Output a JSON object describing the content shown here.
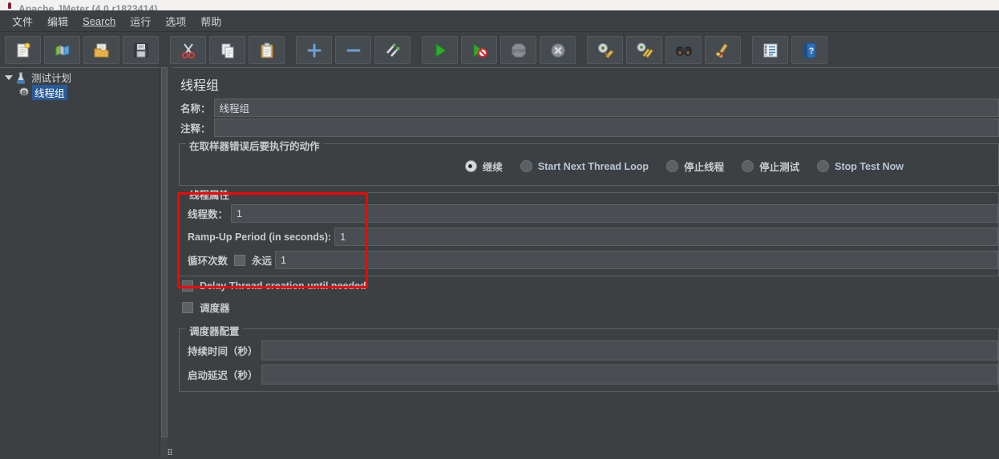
{
  "window": {
    "title": "Apache JMeter (4.0 r1823414)"
  },
  "menubar": {
    "items": [
      {
        "label": "文件",
        "name": "menu-file"
      },
      {
        "label": "编辑",
        "name": "menu-edit"
      },
      {
        "label": "Search",
        "name": "menu-search",
        "mnemonic": "S"
      },
      {
        "label": "运行",
        "name": "menu-run"
      },
      {
        "label": "选项",
        "name": "menu-options"
      },
      {
        "label": "帮助",
        "name": "menu-help"
      }
    ]
  },
  "toolbar": {
    "buttons": [
      {
        "name": "new-icon",
        "tip": "新建"
      },
      {
        "name": "templates-icon",
        "tip": "模板"
      },
      {
        "name": "open-icon",
        "tip": "打开"
      },
      {
        "name": "save-icon",
        "tip": "保存"
      },
      {
        "name": "cut-icon",
        "tip": "剪切"
      },
      {
        "name": "copy-icon",
        "tip": "复制"
      },
      {
        "name": "paste-icon",
        "tip": "粘贴"
      },
      {
        "name": "expand-all-icon",
        "tip": "展开全部"
      },
      {
        "name": "collapse-all-icon",
        "tip": "收起全部"
      },
      {
        "name": "toggle-icon",
        "tip": "切换"
      },
      {
        "name": "start-icon",
        "tip": "启动"
      },
      {
        "name": "start-no-pauses-icon",
        "tip": "无停顿启动"
      },
      {
        "name": "stop-icon",
        "tip": "停止"
      },
      {
        "name": "shutdown-icon",
        "tip": "关闭"
      },
      {
        "name": "clear-icon",
        "tip": "清除"
      },
      {
        "name": "clear-all-icon",
        "tip": "清除全部"
      },
      {
        "name": "search-icon",
        "tip": "搜索"
      },
      {
        "name": "reset-search-icon",
        "tip": "重置搜索"
      },
      {
        "name": "function-helper-icon",
        "tip": "函数助手对话框"
      },
      {
        "name": "help-icon",
        "tip": "帮助"
      }
    ]
  },
  "tree": {
    "nodes": [
      {
        "label": "测试计划",
        "icon": "test-plan-icon",
        "expanded": true,
        "selected": false
      },
      {
        "label": "线程组",
        "icon": "thread-group-icon",
        "expanded": false,
        "selected": true
      }
    ]
  },
  "main": {
    "title": "线程组",
    "name_label": "名称：",
    "name_value": "线程组",
    "comment_label": "注释：",
    "comment_value": "",
    "error_action": {
      "group_title": "在取样器错误后要执行的动作",
      "options": [
        {
          "label": "继续",
          "selected": true,
          "lang": "zh"
        },
        {
          "label": "Start Next Thread Loop",
          "selected": false,
          "lang": "en"
        },
        {
          "label": "停止线程",
          "selected": false,
          "lang": "zh"
        },
        {
          "label": "停止测试",
          "selected": false,
          "lang": "zh"
        },
        {
          "label": "Stop Test Now",
          "selected": false,
          "lang": "en"
        }
      ]
    },
    "thread_properties": {
      "group_title": "线程属性",
      "num_threads_label": "线程数：",
      "num_threads_value": "1",
      "ramp_up_label": "Ramp-Up Period (in seconds):",
      "ramp_up_value": "1",
      "loop_count_label": "循环次数",
      "forever_label": "永远",
      "forever_checked": false,
      "loop_count_value": "1",
      "highlight_color": "#ff0000"
    },
    "delay_thread_creation": {
      "label": "Delay Thread creation until needed",
      "checked": false
    },
    "scheduler": {
      "label": "调度器",
      "checked": false
    },
    "scheduler_config": {
      "group_title": "调度器配置",
      "duration_label": "持续时间（秒）",
      "duration_value": "",
      "startup_delay_label": "启动延迟（秒）",
      "startup_delay_value": ""
    }
  }
}
